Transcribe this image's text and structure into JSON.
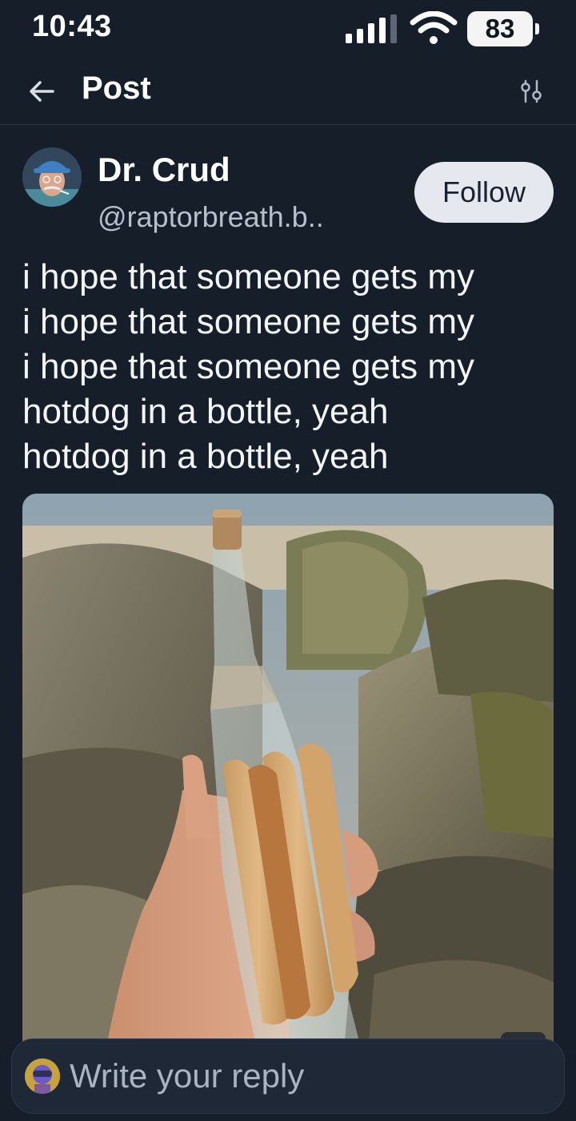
{
  "status_bar": {
    "time": "10:43",
    "battery": "83",
    "icons": [
      "signal-icon",
      "wifi-icon",
      "battery-icon"
    ]
  },
  "header": {
    "title": "Post",
    "icons": [
      "back-arrow-icon",
      "filter-icon"
    ]
  },
  "post": {
    "author": {
      "name": "Dr. Crud",
      "handle": "@raptorbreath.b.."
    },
    "follow_label": "Follow",
    "text_lines": [
      "i hope that someone gets my",
      "i hope that someone gets my",
      "i hope that someone gets my",
      "hotdog in a bottle, yeah",
      "hotdog in a bottle, yeah"
    ]
  },
  "reply": {
    "placeholder": "Write your reply"
  },
  "colors": {
    "background": "#161e29",
    "follow_button_bg": "#e5e9ef",
    "secondary_text": "#b6c0cd"
  }
}
